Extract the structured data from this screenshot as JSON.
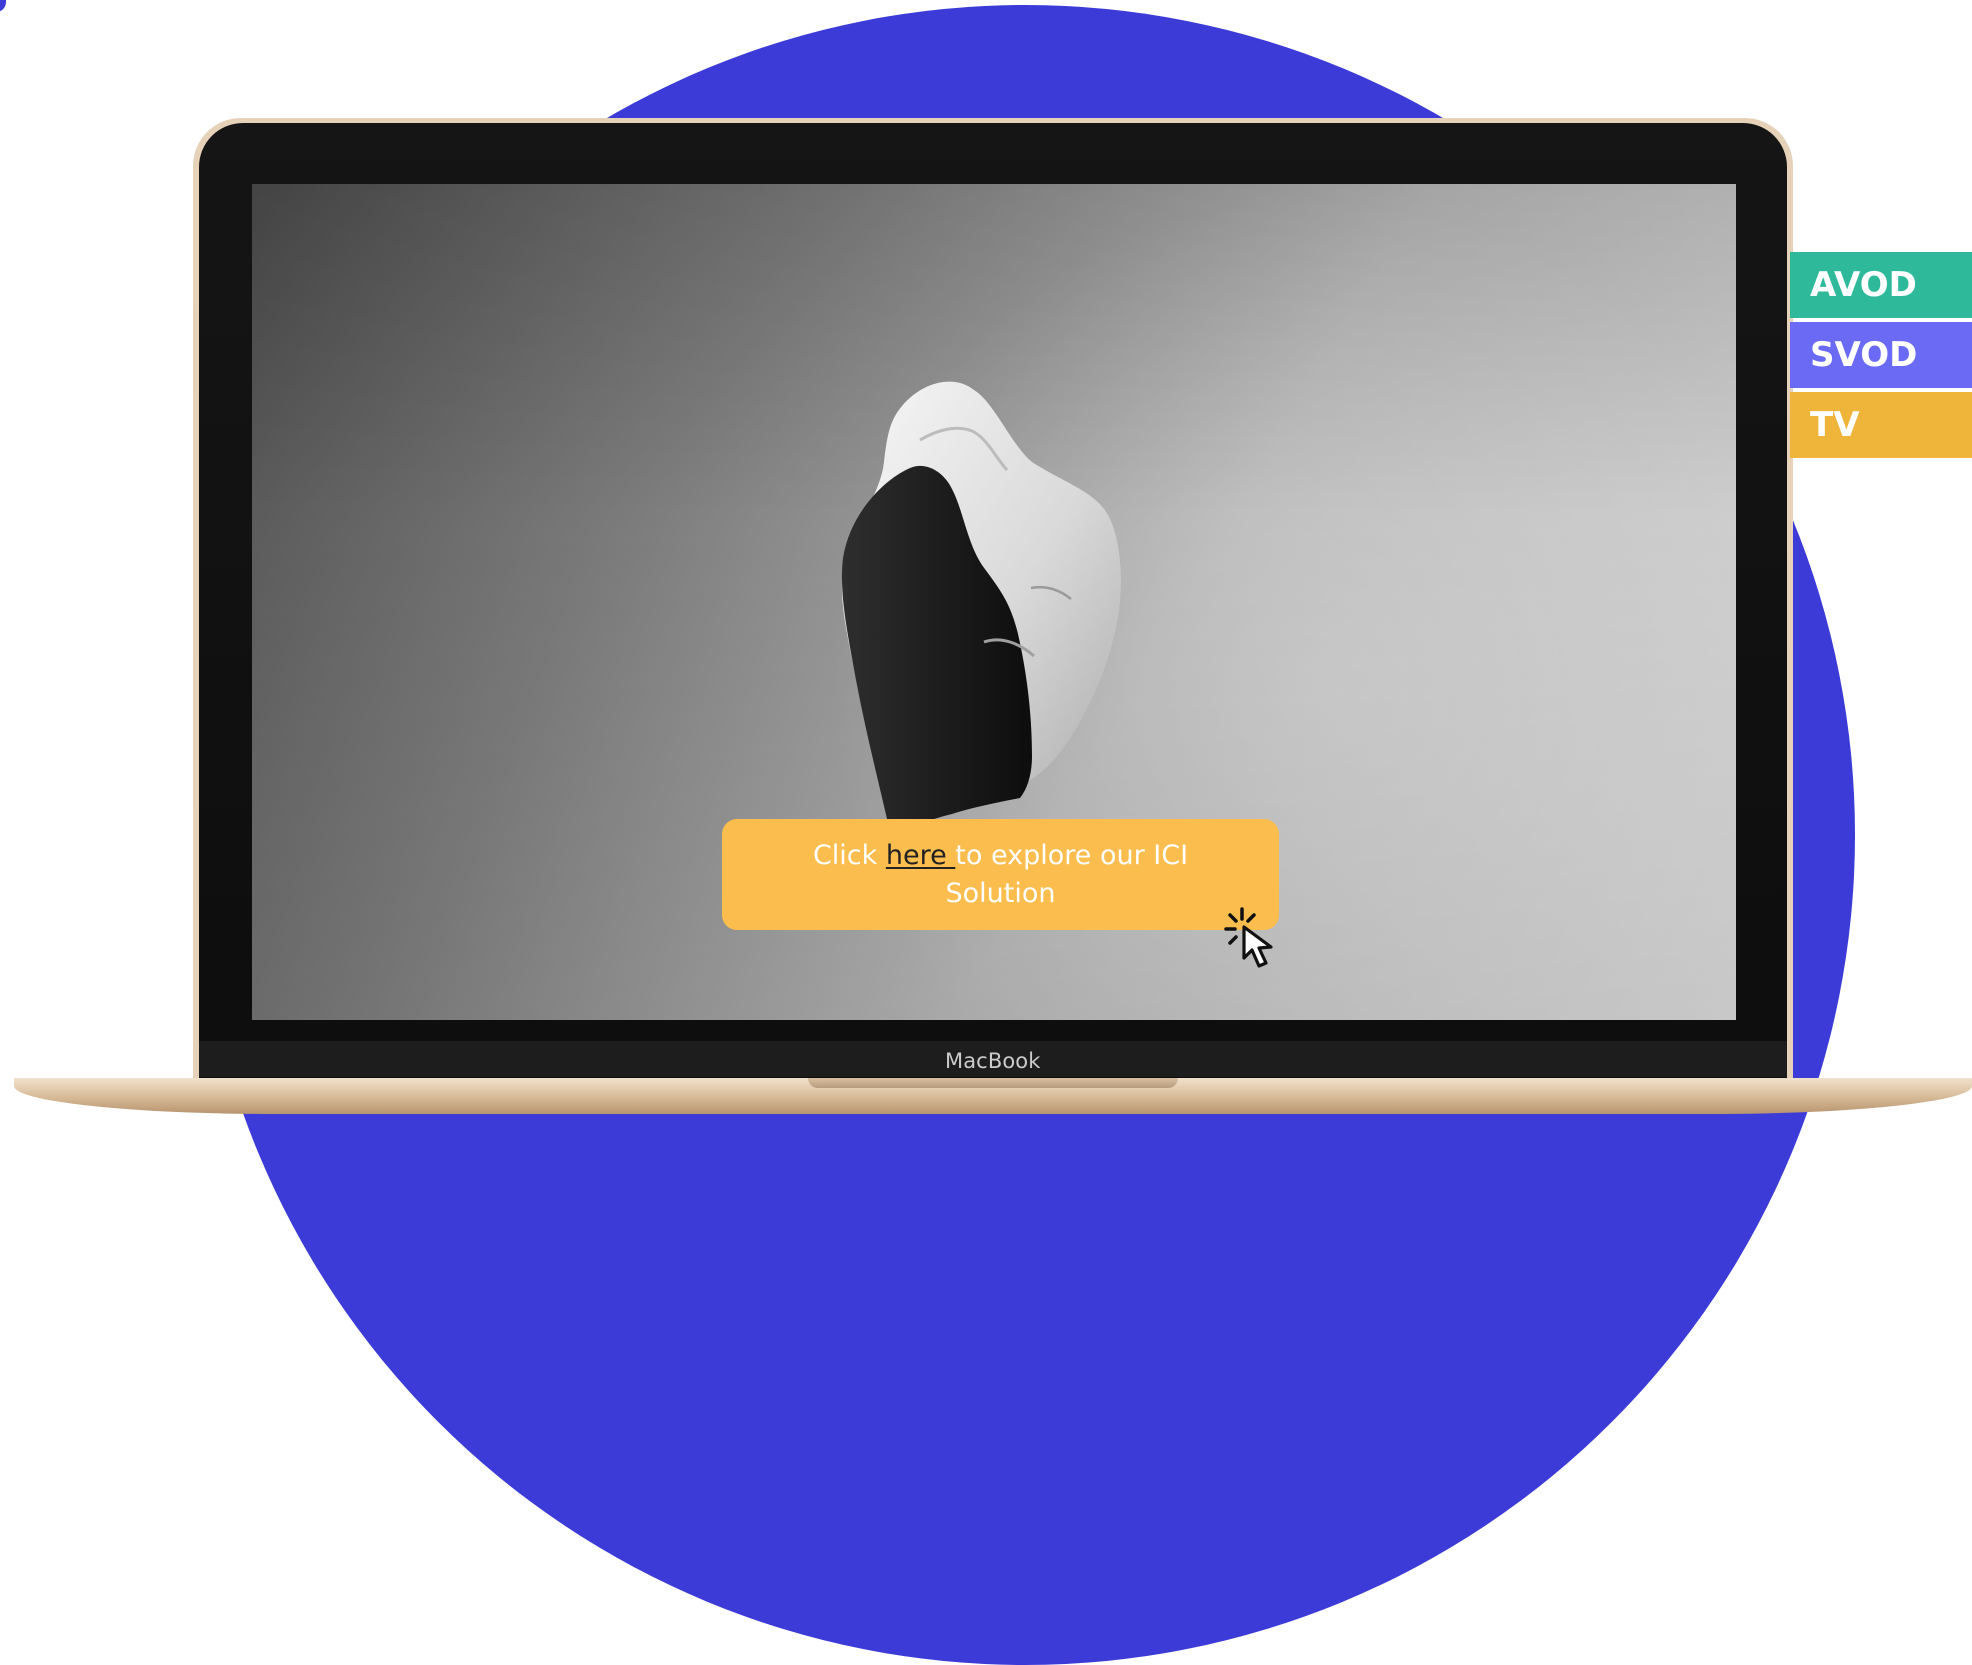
{
  "laptop": {
    "brand": "MacBook"
  },
  "screen": {
    "cta": {
      "before": "Click ",
      "link": "here ",
      "after": "to explore our ICI Solution"
    }
  },
  "side_nav": {
    "items": [
      {
        "label": "AVOD",
        "color": "#2eb99b"
      },
      {
        "label": "SVOD",
        "color": "#6a6af5"
      },
      {
        "label": "TV",
        "color": "#efb43a"
      }
    ]
  },
  "colors": {
    "accent_blue": "#3d3bd8",
    "cta_background": "#fbbd4d"
  },
  "icons": {
    "cursor": "pointer-click-icon"
  }
}
